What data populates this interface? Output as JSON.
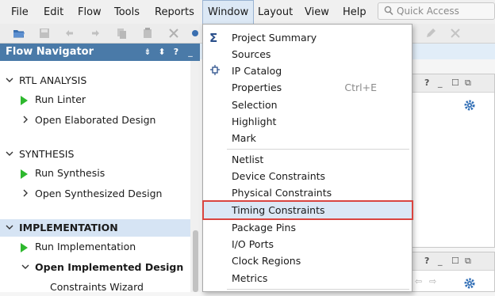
{
  "menubar": {
    "items": [
      "File",
      "Edit",
      "Flow",
      "Tools",
      "Reports",
      "Window",
      "Layout",
      "View",
      "Help"
    ],
    "open_item": "Window",
    "quick_access_placeholder": "Quick Access"
  },
  "flow_navigator": {
    "title": "Flow Navigator",
    "sections": [
      {
        "label": "RTL ANALYSIS",
        "items": [
          "Run Linter",
          "Open Elaborated Design"
        ]
      },
      {
        "label": "SYNTHESIS",
        "items": [
          "Run Synthesis",
          "Open Synthesized Design"
        ]
      },
      {
        "label": "IMPLEMENTATION",
        "items": [
          "Run Implementation",
          "Open Implemented Design"
        ],
        "sub_items": [
          "Constraints Wizard"
        ]
      }
    ]
  },
  "window_menu": {
    "group1": [
      {
        "label": "Project Summary",
        "icon": "sigma-icon"
      },
      {
        "label": "Sources"
      },
      {
        "label": "IP Catalog",
        "icon": "ip-catalog-icon"
      },
      {
        "label": "Properties",
        "accelerator": "Ctrl+E"
      },
      {
        "label": "Selection"
      },
      {
        "label": "Highlight"
      },
      {
        "label": "Mark"
      }
    ],
    "group2": [
      {
        "label": "Netlist"
      },
      {
        "label": "Device Constraints"
      },
      {
        "label": "Physical Constraints"
      },
      {
        "label": "Timing Constraints",
        "highlighted": true
      },
      {
        "label": "Package Pins"
      },
      {
        "label": "I/O Ports"
      },
      {
        "label": "Clock Regions"
      },
      {
        "label": "Metrics"
      }
    ]
  },
  "colors": {
    "header_blue": "#4a7aa8",
    "play_green": "#2eb82e",
    "highlight_outline": "#d9443f",
    "gear_blue": "#2f6db5"
  }
}
